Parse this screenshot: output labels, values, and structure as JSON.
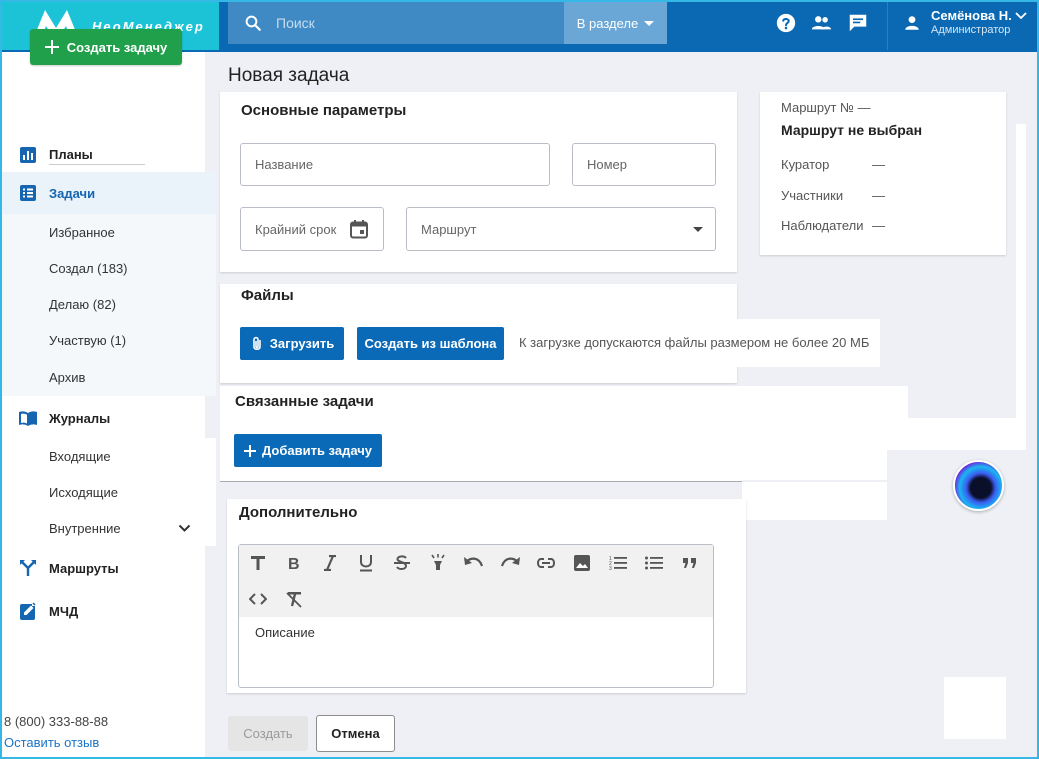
{
  "header": {
    "logo_text": "НеоМенеджер",
    "search_placeholder": "Поиск",
    "scope_label": "В разделе",
    "user_name": "Семёнова Н.",
    "user_role": "Администратор"
  },
  "sidebar": {
    "create_button": "Создать задачу",
    "nav": {
      "plans": "Планы",
      "tasks": "Задачи",
      "journals": "Журналы",
      "routes": "Маршруты",
      "mchd": "МЧД"
    },
    "task_subitems": [
      "Избранное",
      "Создал (183)",
      "Делаю (82)",
      "Участвую (1)",
      "Архив"
    ],
    "journal_subitems": [
      "Входящие",
      "Исходящие",
      "Внутренние"
    ],
    "phone": "8 (800) 333-88-88",
    "feedback": "Оставить отзыв"
  },
  "page": {
    "title": "Новая задача",
    "main_params": {
      "title": "Основные параметры",
      "name_placeholder": "Название",
      "number_placeholder": "Номер",
      "deadline_placeholder": "Крайний срок",
      "route_placeholder": "Маршрут"
    },
    "files": {
      "title": "Файлы",
      "upload_button": "Загрузить",
      "template_button": "Создать из шаблона",
      "hint": "К загрузке допускаются файлы размером не более 20 МБ"
    },
    "linked": {
      "title": "Связанные задачи",
      "add_button": "Добавить задачу"
    },
    "additional": {
      "title": "Дополнительно",
      "description_placeholder": "Описание"
    },
    "route_card": {
      "route_no": "Маршрут № —",
      "route_status": "Маршрут не выбран",
      "curator_label": "Куратор",
      "curator_value": "—",
      "participants_label": "Участники",
      "participants_value": "—",
      "observers_label": "Наблюдатели",
      "observers_value": "—"
    },
    "actions": {
      "create": "Создать",
      "cancel": "Отмена"
    }
  },
  "colors": {
    "header": "#0b69b3",
    "logo_bg": "#1cc3d6",
    "primary": "#0b6ab8",
    "success": "#21a04b",
    "border": "#35b8e6"
  }
}
